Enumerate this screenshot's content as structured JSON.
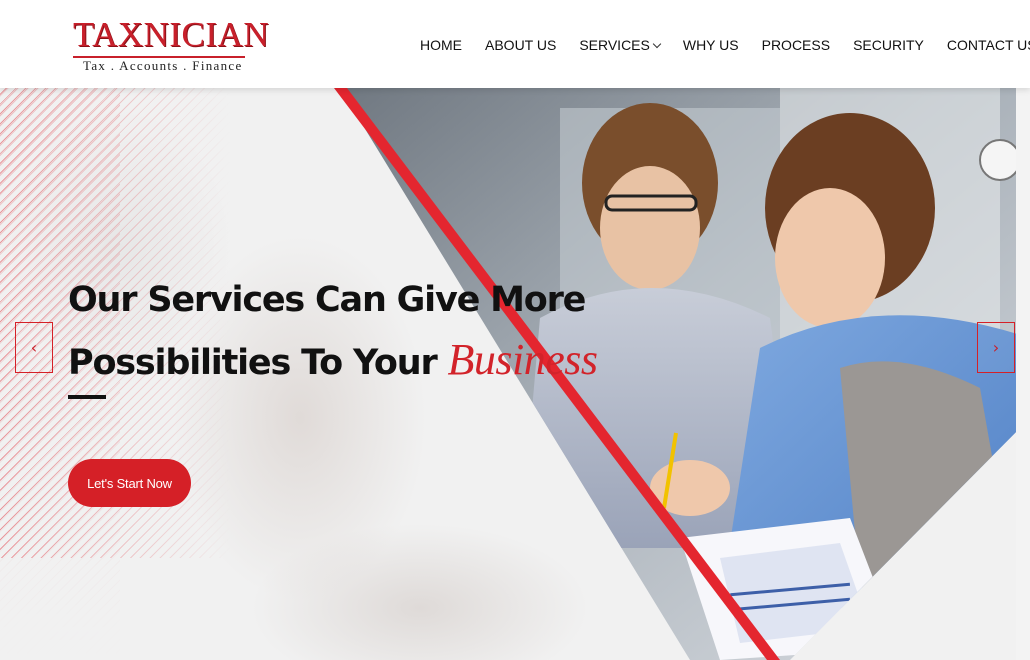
{
  "brand": {
    "name": "TAXNICIAN",
    "tagline": "Tax . Accounts . Finance",
    "accent_color": "#d52027"
  },
  "nav": {
    "items": [
      {
        "label": "HOME"
      },
      {
        "label": "ABOUT US"
      },
      {
        "label": "SERVICES",
        "has_dropdown": true
      },
      {
        "label": "WHY US"
      },
      {
        "label": "PROCESS"
      },
      {
        "label": "SECURITY"
      },
      {
        "label": "CONTACT US"
      }
    ]
  },
  "hero": {
    "headline_line1": "Our Services Can Give More",
    "headline_line2_prefix": "Possibilities To Your ",
    "headline_accent": "Business",
    "cta_label": "Let's Start Now",
    "prev_icon": "chevron-left-icon",
    "next_icon": "chevron-right-icon"
  }
}
